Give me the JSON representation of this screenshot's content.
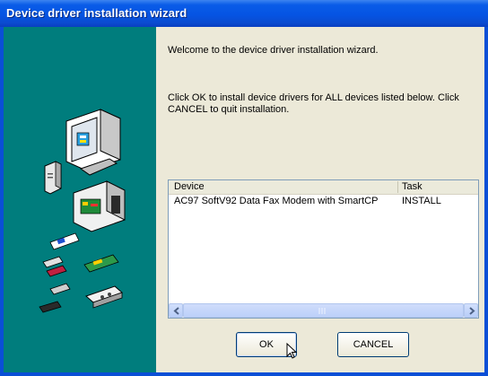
{
  "window": {
    "title": "Device driver installation wizard"
  },
  "main": {
    "welcome_text": "Welcome to the device driver installation wizard.",
    "instructions_line1": "Click OK to install device drivers for ALL devices listed below. Click",
    "instructions_line2": "CANCEL to quit installation."
  },
  "device_list": {
    "columns": {
      "device": "Device",
      "task": "Task"
    },
    "rows": [
      {
        "device": "AC97 SoftV92 Data Fax Modem with SmartCP",
        "task": "INSTALL"
      }
    ]
  },
  "buttons": {
    "ok_label": "OK",
    "cancel_label": "CANCEL"
  },
  "colors": {
    "titlebar": "#0554e3",
    "side_panel": "#007d7d",
    "dialog_bg": "#ece9d8"
  }
}
